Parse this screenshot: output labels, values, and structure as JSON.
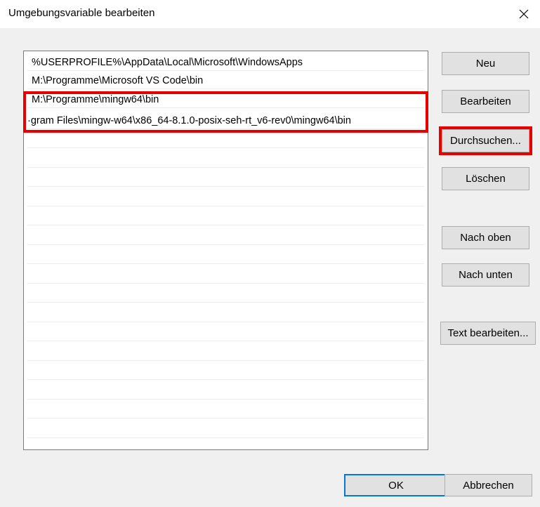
{
  "window": {
    "title": "Umgebungsvariable bearbeiten"
  },
  "paths": [
    "%USERPROFILE%\\AppData\\Local\\Microsoft\\WindowsApps",
    "M:\\Programme\\Microsoft VS Code\\bin",
    "M:\\Programme\\mingw64\\bin",
    "·gram Files\\mingw-w64\\x86_64-8.1.0-posix-seh-rt_v6-rev0\\mingw64\\bin"
  ],
  "buttons": {
    "new": "Neu",
    "edit": "Bearbeiten",
    "browse": "Durchsuchen...",
    "delete": "Löschen",
    "move_up": "Nach oben",
    "move_down": "Nach unten",
    "edit_text": "Text bearbeiten...",
    "ok": "OK",
    "cancel": "Abbrechen"
  },
  "colors": {
    "highlight": "#e60000",
    "accent": "#0078d7"
  }
}
